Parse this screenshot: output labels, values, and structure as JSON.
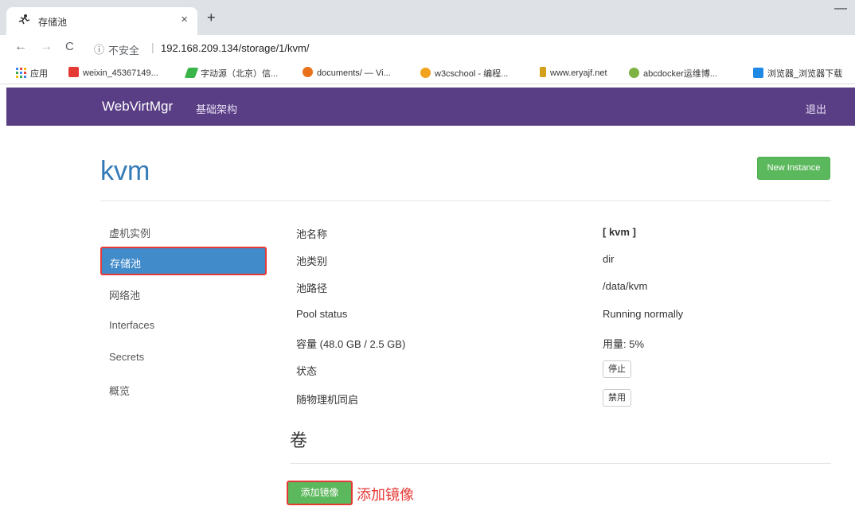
{
  "browser": {
    "tab_title": "存储池",
    "tab_close": "×",
    "new_tab": "+",
    "url_info": "ⓘ",
    "insecure": "不安全",
    "url": "192.168.209.134/storage/1/kvm/",
    "bookmarks": [
      {
        "label": "应用",
        "color": "#e0452f"
      },
      {
        "label": "weixin_45367149...",
        "color": "#e53935"
      },
      {
        "label": "字动源（北京）信...",
        "color": "#3bb54a"
      },
      {
        "label": "documents/ — Vi...",
        "color": "#e8711a"
      },
      {
        "label": "w3cschool - 编程...",
        "color": "#f2a31b"
      },
      {
        "label": "www.eryajf.net",
        "color": "#d4a017"
      },
      {
        "label": "abcdocker运维博...",
        "color": "#7cb342"
      },
      {
        "label": "浏览器_浏览器下载",
        "color": "#1e88e5"
      }
    ]
  },
  "navbar": {
    "brand": "WebVirtMgr",
    "link": "基础架构",
    "logout": "退出"
  },
  "page": {
    "title": "kvm",
    "new_instance": "New Instance"
  },
  "sidebar": {
    "items": [
      "虚机实例",
      "存储池",
      "网络池",
      "Interfaces",
      "Secrets",
      "概览"
    ]
  },
  "pool": {
    "rows": [
      {
        "label": "池名称",
        "value": "[ kvm ]"
      },
      {
        "label": "池类别",
        "value": "dir"
      },
      {
        "label": "池路径",
        "value": "/data/kvm"
      },
      {
        "label": "Pool status",
        "value": "Running normally"
      },
      {
        "label": "容量 (48.0 GB / 2.5 GB)",
        "value": "用量: 5%"
      },
      {
        "label": "状态",
        "value": "停止"
      },
      {
        "label": "随物理机同启",
        "value": "禁用"
      }
    ]
  },
  "volumes": {
    "title": "卷",
    "add_button": "添加镜像",
    "annotation": "添加镜像"
  },
  "colors": {
    "navbar": "#5a3e85",
    "link": "#337ab7",
    "success": "#5cb85c",
    "active": "#428bca",
    "highlight": "#e53935"
  }
}
